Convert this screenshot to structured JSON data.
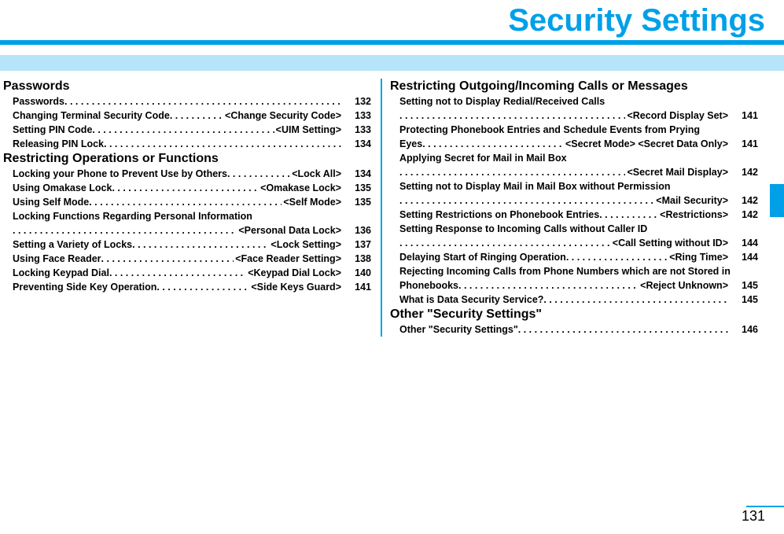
{
  "title": "Security Settings",
  "page_number": "131",
  "left": {
    "sections": [
      {
        "heading": "Passwords",
        "items": [
          {
            "label": "Passwords",
            "menu": "",
            "page": "132"
          },
          {
            "label": "Changing Terminal Security Code",
            "menu": "<Change Security Code>",
            "page": "133"
          },
          {
            "label": "Setting PIN Code",
            "menu": "<UIM Setting>",
            "page": "133"
          },
          {
            "label": "Releasing PIN Lock",
            "menu": "",
            "page": "134"
          }
        ]
      },
      {
        "heading": "Restricting Operations or Functions",
        "items": [
          {
            "label": "Locking your Phone to Prevent Use by Others",
            "menu": "<Lock All>",
            "page": "134"
          },
          {
            "label": "Using Omakase Lock",
            "menu": "<Omakase Lock>",
            "page": "135"
          },
          {
            "label": "Using Self Mode",
            "menu": "<Self Mode>",
            "page": "135"
          },
          {
            "label": "Locking Functions Regarding Personal Information",
            "wrap": true,
            "menu": "<Personal Data Lock>",
            "page": "136"
          },
          {
            "label": "Setting a Variety of Locks",
            "menu": "<Lock Setting>",
            "page": "137"
          },
          {
            "label": "Using Face Reader",
            "menu": "<Face Reader Setting>",
            "page": "138"
          },
          {
            "label": "Locking Keypad Dial",
            "menu": "<Keypad Dial Lock>",
            "page": "140"
          },
          {
            "label": "Preventing Side Key Operation",
            "menu": "<Side Keys Guard>",
            "page": "141"
          }
        ]
      }
    ]
  },
  "right": {
    "sections": [
      {
        "heading": "Restricting Outgoing/Incoming Calls or Messages",
        "items": [
          {
            "label": "Setting not to Display Redial/Received Calls",
            "wrap": true,
            "menu": "<Record Display Set>",
            "page": "141"
          },
          {
            "label": "Protecting Phonebook Entries and Schedule Events from Prying Eyes",
            "wrap_inline": true,
            "menu": "<Secret Mode> <Secret Data Only>",
            "page": "141"
          },
          {
            "label": "Applying Secret for Mail in Mail Box",
            "wrap": true,
            "menu": "<Secret Mail Display>",
            "page": "142"
          },
          {
            "label": "Setting not to Display Mail in Mail Box without Permission",
            "wrap": true,
            "menu": "<Mail Security>",
            "page": "142"
          },
          {
            "label": "Setting Restrictions on Phonebook Entries",
            "menu": "<Restrictions>",
            "page": "142"
          },
          {
            "label": "Setting Response to Incoming Calls without Caller ID",
            "wrap": true,
            "menu": "<Call Setting without ID>",
            "page": "144"
          },
          {
            "label": "Delaying Start of Ringing Operation",
            "menu": "<Ring Time>",
            "page": "144"
          },
          {
            "label": "Rejecting Incoming Calls from Phone Numbers which are not Stored in Phonebooks",
            "wrap_inline": true,
            "menu": "<Reject Unknown>",
            "page": "145"
          },
          {
            "label": "What is Data Security Service?",
            "menu": "",
            "page": "145"
          }
        ]
      },
      {
        "heading": "Other \"Security Settings\"",
        "items": [
          {
            "label": "Other \"Security Settings\"",
            "menu": "",
            "page": "146"
          }
        ]
      }
    ]
  }
}
